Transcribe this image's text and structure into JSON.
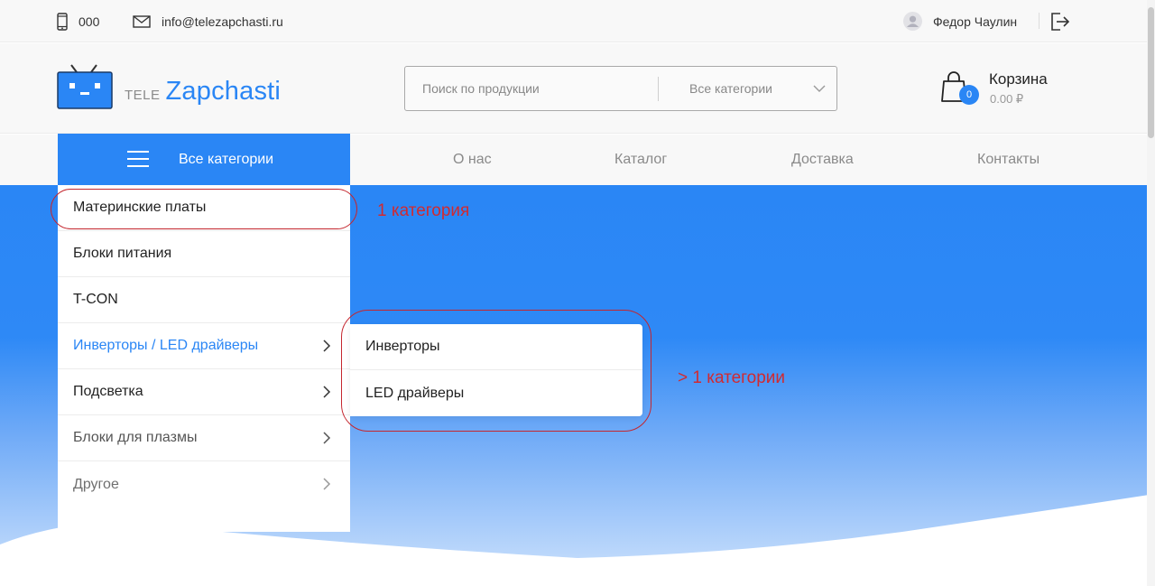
{
  "topbar": {
    "phone": "000",
    "email": "info@telezapchasti.ru",
    "user_name": "Федор Чаулин",
    "icons": [
      "phone-icon",
      "mail-icon",
      "user-avatar-icon",
      "logout-icon"
    ]
  },
  "header": {
    "logo_prefix": "TELE",
    "logo_name": "Zapchasti",
    "search_placeholder": "Поиск по продукции",
    "search_category": "Все категории",
    "cart_title": "Корзина",
    "cart_count": "0",
    "cart_total": "0.00 ₽"
  },
  "nav": {
    "all_categories": "Все категории",
    "links": [
      "О нас",
      "Каталог",
      "Доставка",
      "Контакты"
    ]
  },
  "menu": {
    "items": [
      {
        "label": "Материнские платы",
        "has_children": false
      },
      {
        "label": "Блоки питания",
        "has_children": false
      },
      {
        "label": "T-CON",
        "has_children": false
      },
      {
        "label": "Инверторы / LED драйверы",
        "has_children": true,
        "active": true
      },
      {
        "label": "Подсветка",
        "has_children": true
      },
      {
        "label": "Блоки для плазмы",
        "has_children": true
      },
      {
        "label": "Другое",
        "has_children": true
      }
    ],
    "submenu": [
      "Инверторы",
      "LED драйверы"
    ]
  },
  "annotations": {
    "single": "1 категория",
    "multiple": "> 1 категории"
  },
  "colors": {
    "accent": "#2a86f5",
    "annotation": "#c4262e",
    "hero_top": "#2a86f5",
    "hero_bottom": "#c9e0fb"
  }
}
